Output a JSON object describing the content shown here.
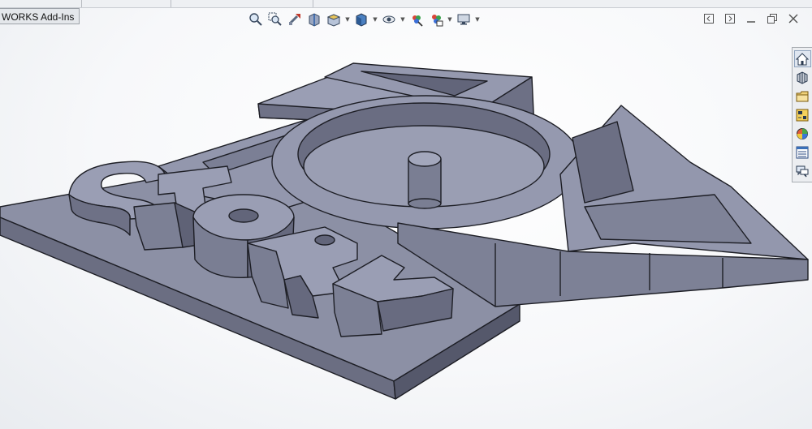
{
  "tabs": {
    "addins_label": "WORKS Add-Ins"
  },
  "heads_up_toolbar": {
    "items": [
      "zoom-to-fit-icon",
      "zoom-to-area-icon",
      "previous-view-icon",
      "section-view-icon",
      "view-orientation-icon",
      "display-style-icon",
      "hide-show-items-icon",
      "edit-appearance-icon",
      "apply-scene-icon",
      "view-settings-icon"
    ]
  },
  "window_controls": [
    "restore-left-icon",
    "restore-right-icon",
    "minimize-icon",
    "restore-icon",
    "close-icon"
  ],
  "task_pane": {
    "items": [
      "home-icon",
      "design-library-icon",
      "file-explorer-icon",
      "view-palette-icon",
      "appearances-icon",
      "custom-properties-icon",
      "forum-icon"
    ]
  },
  "colors": {
    "model_top": "#8f93a8",
    "model_side_light": "#7d8196",
    "model_side_dark": "#5f6276",
    "edge": "#1d1e25",
    "viewport_bg": "#f7f8fa"
  }
}
